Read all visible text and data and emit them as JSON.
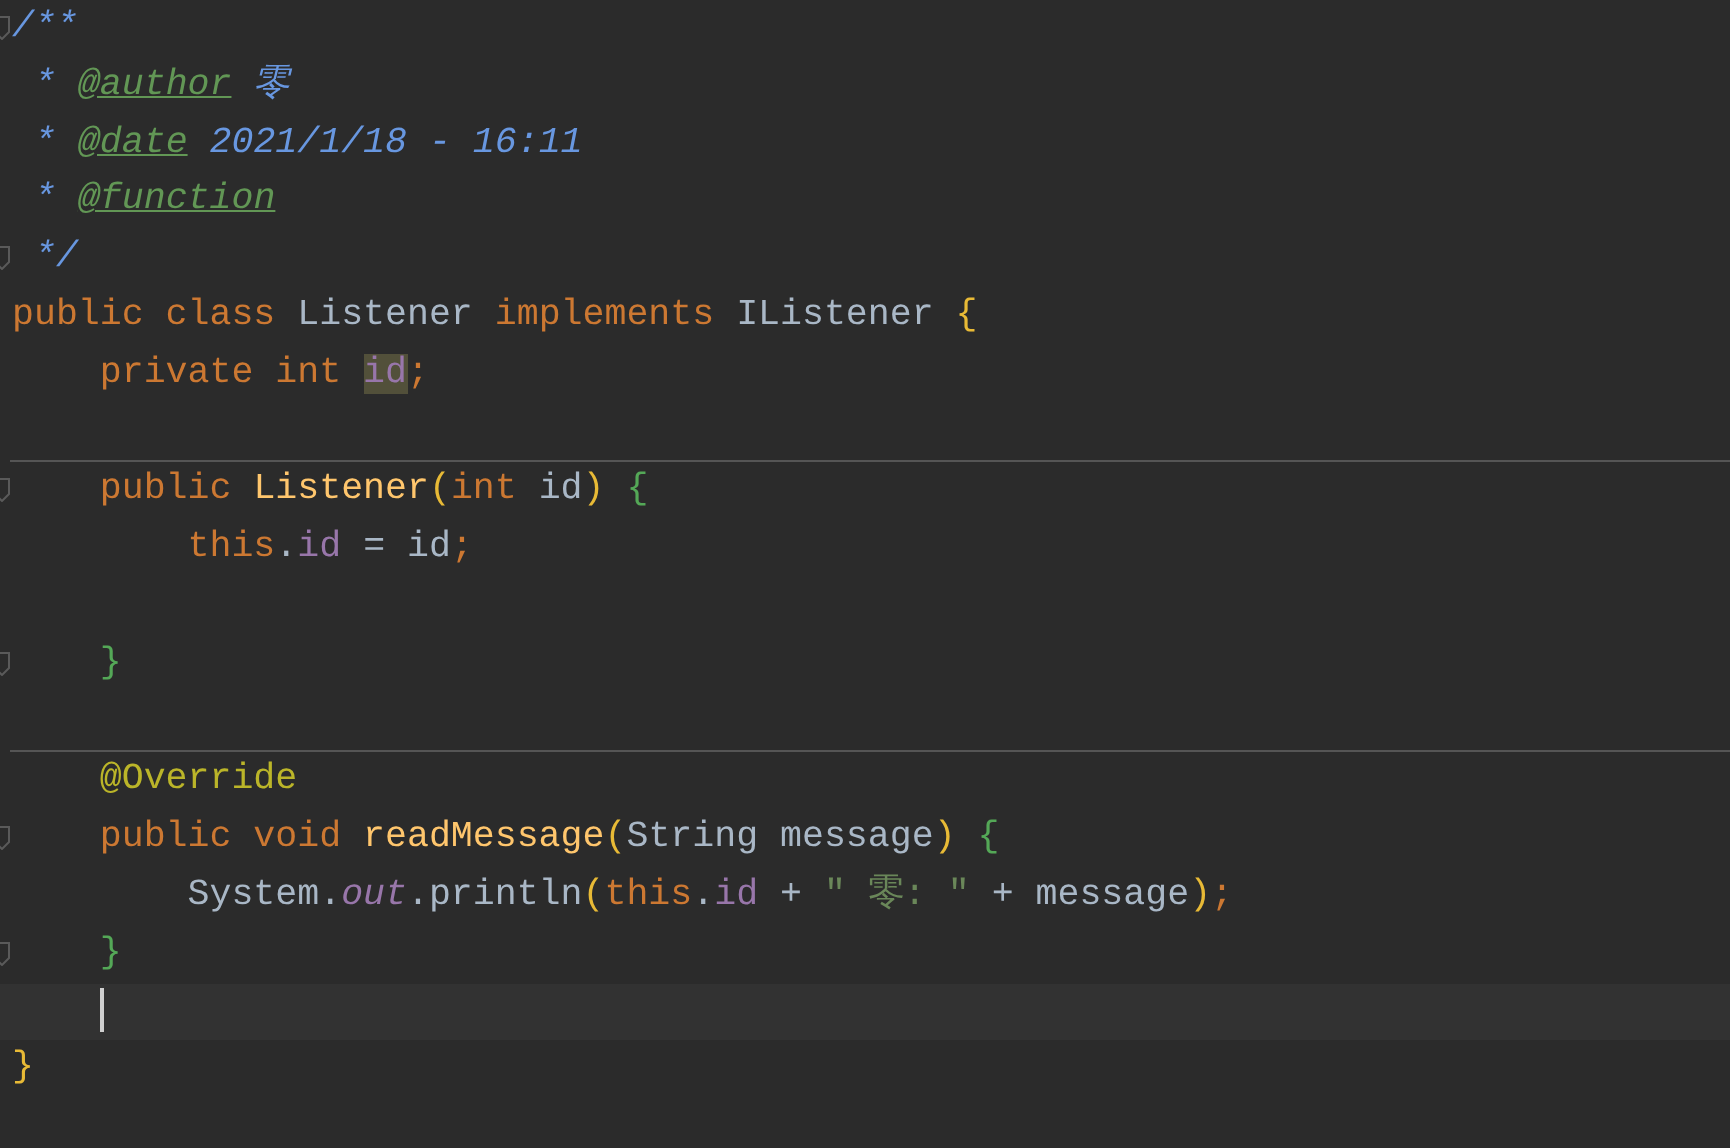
{
  "editor": {
    "lines": [
      {
        "kind": "code",
        "gutter": {
          "kind": "fold"
        },
        "tokens": [
          {
            "text": "/**",
            "kind": "doc"
          }
        ]
      },
      {
        "kind": "code",
        "tokens": [
          {
            "text": " * ",
            "kind": "doc"
          },
          {
            "text": "@author",
            "kind": "doctag"
          },
          {
            "text": " 零",
            "kind": "doc"
          }
        ]
      },
      {
        "kind": "code",
        "tokens": [
          {
            "text": " * ",
            "kind": "doc"
          },
          {
            "text": "@date",
            "kind": "doctag"
          },
          {
            "text": " 2021/1/18 - 16:11",
            "kind": "doc"
          }
        ]
      },
      {
        "kind": "code",
        "tokens": [
          {
            "text": " * ",
            "kind": "doc"
          },
          {
            "text": "@function",
            "kind": "doctag"
          }
        ]
      },
      {
        "kind": "code",
        "gutter": {
          "kind": "fold"
        },
        "tokens": [
          {
            "text": " */",
            "kind": "doc"
          }
        ]
      },
      {
        "kind": "code",
        "tokens": [
          {
            "text": "public class ",
            "kind": "keyword"
          },
          {
            "text": "Listener ",
            "kind": "plain"
          },
          {
            "text": "implements ",
            "kind": "keyword"
          },
          {
            "text": "IListener ",
            "kind": "plain"
          },
          {
            "text": "{",
            "kind": "bracket"
          }
        ]
      },
      {
        "kind": "code",
        "tokens": [
          {
            "text": "    private int ",
            "kind": "keyword"
          },
          {
            "text": "id",
            "kind": "usage"
          },
          {
            "text": ";",
            "kind": "keyword"
          }
        ]
      },
      {
        "kind": "blank"
      },
      {
        "kind": "separator"
      },
      {
        "kind": "code",
        "gutter": {
          "kind": "fold"
        },
        "tokens": [
          {
            "text": "    public ",
            "kind": "keyword"
          },
          {
            "text": "Listener",
            "kind": "method"
          },
          {
            "text": "(",
            "kind": "bracket"
          },
          {
            "text": "int ",
            "kind": "keyword"
          },
          {
            "text": "id",
            "kind": "plain"
          },
          {
            "text": ") ",
            "kind": "bracket"
          },
          {
            "text": "{",
            "kind": "brace"
          }
        ]
      },
      {
        "kind": "code",
        "tokens": [
          {
            "text": "        this",
            "kind": "keyword"
          },
          {
            "text": ".",
            "kind": "plain"
          },
          {
            "text": "id",
            "kind": "field"
          },
          {
            "text": " = id",
            "kind": "plain"
          },
          {
            "text": ";",
            "kind": "keyword"
          }
        ]
      },
      {
        "kind": "blank"
      },
      {
        "kind": "code",
        "gutter": {
          "kind": "fold"
        },
        "tokens": [
          {
            "text": "    }",
            "kind": "brace"
          }
        ]
      },
      {
        "kind": "blank"
      },
      {
        "kind": "separator"
      },
      {
        "kind": "code",
        "tokens": [
          {
            "text": "    @Override",
            "kind": "annotation"
          }
        ]
      },
      {
        "kind": "code",
        "gutter": {
          "kind": "fold"
        },
        "tokens": [
          {
            "text": "    public void ",
            "kind": "keyword"
          },
          {
            "text": "readMessage",
            "kind": "method"
          },
          {
            "text": "(",
            "kind": "bracket"
          },
          {
            "text": "String message",
            "kind": "plain"
          },
          {
            "text": ") ",
            "kind": "bracket"
          },
          {
            "text": "{",
            "kind": "brace"
          }
        ]
      },
      {
        "kind": "code",
        "tokens": [
          {
            "text": "        System.",
            "kind": "plain"
          },
          {
            "text": "out",
            "kind": "static"
          },
          {
            "text": ".println",
            "kind": "plain"
          },
          {
            "text": "(",
            "kind": "bracket"
          },
          {
            "text": "this",
            "kind": "keyword"
          },
          {
            "text": ".",
            "kind": "plain"
          },
          {
            "text": "id",
            "kind": "field"
          },
          {
            "text": " + ",
            "kind": "plain"
          },
          {
            "text": "\" 零: \"",
            "kind": "string"
          },
          {
            "text": " + message",
            "kind": "plain"
          },
          {
            "text": ")",
            "kind": "bracket"
          },
          {
            "text": ";",
            "kind": "keyword"
          }
        ]
      },
      {
        "kind": "code",
        "gutter": {
          "kind": "fold"
        },
        "tokens": [
          {
            "text": "    }",
            "kind": "brace"
          }
        ]
      },
      {
        "kind": "caret"
      },
      {
        "kind": "code",
        "tokens": [
          {
            "text": "}",
            "kind": "bracket"
          }
        ]
      }
    ]
  }
}
